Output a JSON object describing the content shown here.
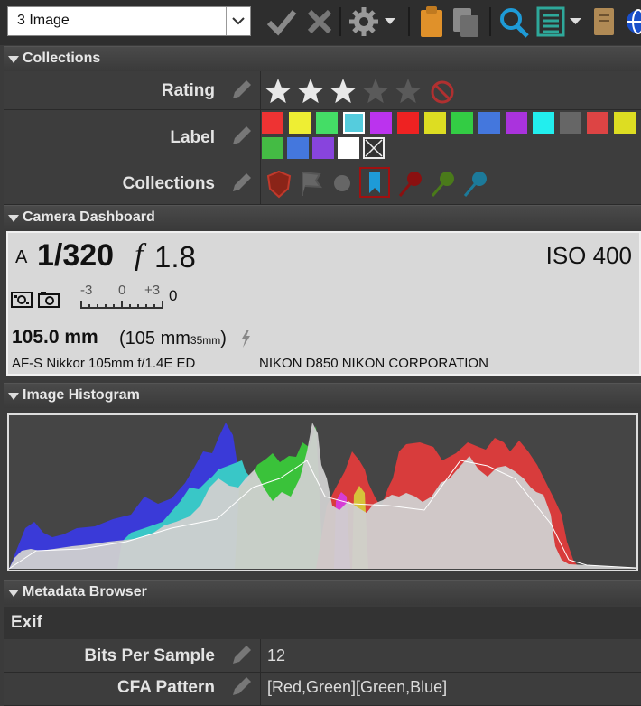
{
  "toolbar": {
    "selection_value": "3 Image"
  },
  "panels": {
    "collections": "Collections",
    "camera_dashboard": "Camera Dashboard",
    "image_histogram": "Image Histogram",
    "metadata_browser": "Metadata Browser"
  },
  "rating": {
    "label": "Rating",
    "stars_filled": 3,
    "stars_total": 5
  },
  "label": {
    "label": "Label",
    "colors_row1": [
      "#ee3333",
      "#eeee33",
      "#44dd66",
      "#55ccdd",
      "#bb33ee",
      "#ee2222",
      "#dddd22",
      "#33cc44",
      "#4477dd",
      "#aa33dd",
      "#22eeee",
      "#666666",
      "#dd4444",
      "#dddd22"
    ],
    "colors_row2": [
      "#44bb44",
      "#4477dd",
      "#8844dd",
      "#ffffff"
    ],
    "selected_index": 3
  },
  "collections_row": {
    "label": "Collections"
  },
  "dashboard": {
    "mode": "A",
    "shutter": "1/320",
    "f_symbol": "f",
    "aperture": "1.8",
    "iso": "ISO 400",
    "ev_minus": "-3",
    "ev_zero": "0",
    "ev_plus": "+3",
    "ev_value": "0",
    "focal": "105.0 mm",
    "focal35_open": "(105 mm",
    "focal35_sub": "35mm",
    "focal35_close": ")",
    "lens": "AF-S Nikkor 105mm f/1.4E ED",
    "camera": "NIKON D850 NIKON CORPORATION"
  },
  "metadata": {
    "section": "Exif",
    "rows": [
      {
        "label": "Bits Per Sample",
        "value": "12"
      },
      {
        "label": "CFA Pattern",
        "value": "[Red,Green][Green,Blue]"
      }
    ]
  },
  "colors": {
    "accent_blue": "#1e9bd7",
    "clipboard_orange": "#e0912a"
  }
}
